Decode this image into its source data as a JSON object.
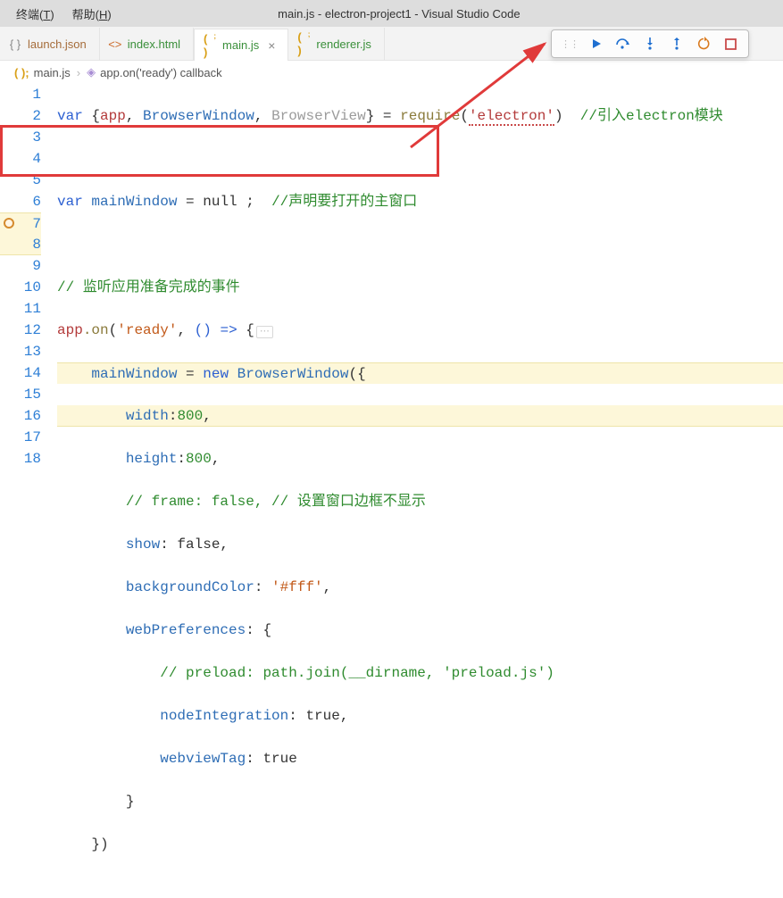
{
  "menubar": {
    "terminal": "终端",
    "terminal_key": "T",
    "help": "帮助",
    "help_key": "H"
  },
  "window_title": "main.js - electron-project1 - Visual Studio Code",
  "tabs": [
    {
      "label": "launch.json",
      "icon": "json"
    },
    {
      "label": "index.html",
      "icon": "html"
    },
    {
      "label": "main.js",
      "icon": "js",
      "active": true
    },
    {
      "label": "renderer.js",
      "icon": "js"
    }
  ],
  "debug_toolbar": {
    "continue": "continue-icon",
    "step_over": "step-over-icon",
    "step_into": "step-into-icon",
    "step_out": "step-out-icon",
    "restart": "restart-icon",
    "stop": "stop-icon"
  },
  "breadcrumb": {
    "file": "main.js",
    "symbol": "app.on('ready') callback"
  },
  "code": {
    "l1_var": "var",
    "l1_brace_o": "{",
    "l1_app": "app",
    "l1_c1": ", ",
    "l1_bw": "BrowserWindow",
    "l1_c2": ", ",
    "l1_bv": "BrowserView",
    "l1_brace_c": "}",
    "l1_eq": " = ",
    "l1_req": "require",
    "l1_p": "(",
    "l1_str": "'electron'",
    "l1_pc": ")",
    "l1_cmt": "  //引入electron模块",
    "l3_var": "var",
    "l3_mw": " mainWindow",
    "l3_eqnull": " = null ;",
    "l3_cmt": "  //声明要打开的主窗口",
    "l5_cmt": "// 监听应用准备完成的事件",
    "l6_app": "app",
    "l6_on": ".on",
    "l6_p": "(",
    "l6_str": "'ready'",
    "l6_c": ", ",
    "l6_arrow": "() =>",
    "l6_brace": " {",
    "l7_mw": "mainWindow",
    "l7_eq": " = ",
    "l7_new": "new",
    "l7_sp": " ",
    "l7_bw": "BrowserWindow",
    "l7_po": "(",
    "l7_brace": "{",
    "l8_prop": "width",
    "l8_colon": ":",
    "l8_val": "800",
    "l8_c": ",",
    "l9_prop": "height",
    "l9_colon": ":",
    "l9_val": "800",
    "l9_c": ",",
    "l10_cmt": "// frame: false, // 设置窗口边框不显示",
    "l11_prop": "show",
    "l11_v": ": false,",
    "l12_prop": "backgroundColor",
    "l12_c": ": ",
    "l12_v": "'#fff'",
    "l12_cc": ",",
    "l13_prop": "webPreferences",
    "l13_b": ": {",
    "l14_cmt": "// preload: path.join(__dirname, 'preload.js')",
    "l15_prop": "nodeIntegration",
    "l15_v": ": true,",
    "l16_prop": "webviewTag",
    "l16_v": ": true",
    "l17_brace": "}",
    "l18_brace": "})"
  },
  "line_numbers": [
    "1",
    "2",
    "3",
    "4",
    "5",
    "6",
    "7",
    "8",
    "9",
    "10",
    "11",
    "12",
    "13",
    "14",
    "15",
    "16",
    "17",
    "18"
  ],
  "breakpoint_line": 7,
  "highlight_lines": [
    7,
    8
  ]
}
